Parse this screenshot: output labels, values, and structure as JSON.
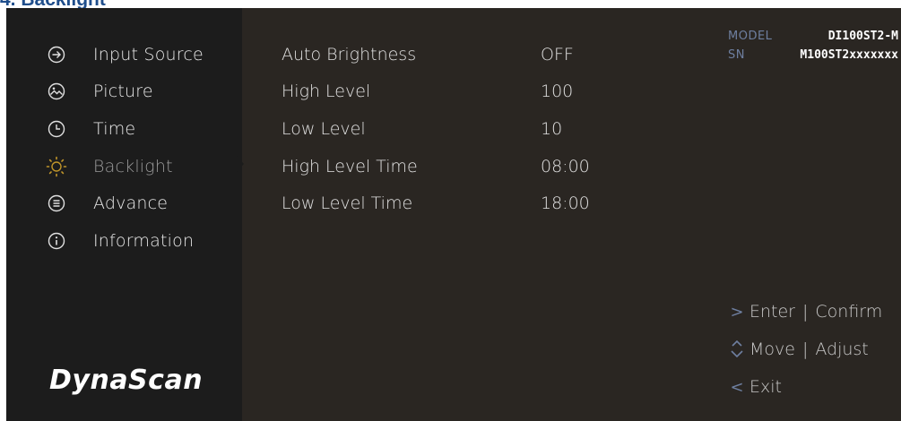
{
  "doc_heading": "4. Backlight",
  "sidebar": {
    "items": [
      {
        "label": "Input Source",
        "icon": "input-source-icon",
        "active": false
      },
      {
        "label": "Picture",
        "icon": "picture-icon",
        "active": false
      },
      {
        "label": "Time",
        "icon": "clock-icon",
        "active": false
      },
      {
        "label": "Backlight",
        "icon": "backlight-icon",
        "active": true
      },
      {
        "label": "Advance",
        "icon": "advance-icon",
        "active": false
      },
      {
        "label": "Information",
        "icon": "information-icon",
        "active": false
      }
    ],
    "logo": "DynaScan"
  },
  "settings": [
    {
      "name": "Auto Brightness",
      "value": "OFF"
    },
    {
      "name": "High Level",
      "value": "100"
    },
    {
      "name": "Low Level",
      "value": "10"
    },
    {
      "name": "High Level Time",
      "value": "08:00"
    },
    {
      "name": "Low Level Time",
      "value": "18:00"
    }
  ],
  "info": {
    "model_label": "MODEL",
    "model_value": "DI100ST2-M",
    "sn_label": "SN",
    "sn_value": "M100ST2xxxxxxx"
  },
  "hints": {
    "enter_symbol": ">",
    "enter": "Enter",
    "confirm": "Confirm",
    "move": "Move",
    "adjust": "Adjust",
    "exit_symbol": "<",
    "exit": "Exit",
    "separator": "|"
  },
  "colors": {
    "background": "#2a2622",
    "sidebar": "#1c1c1c",
    "active_icon": "#c0952a",
    "info_label": "#6e7fa0",
    "heading": "#1f4e8c"
  }
}
